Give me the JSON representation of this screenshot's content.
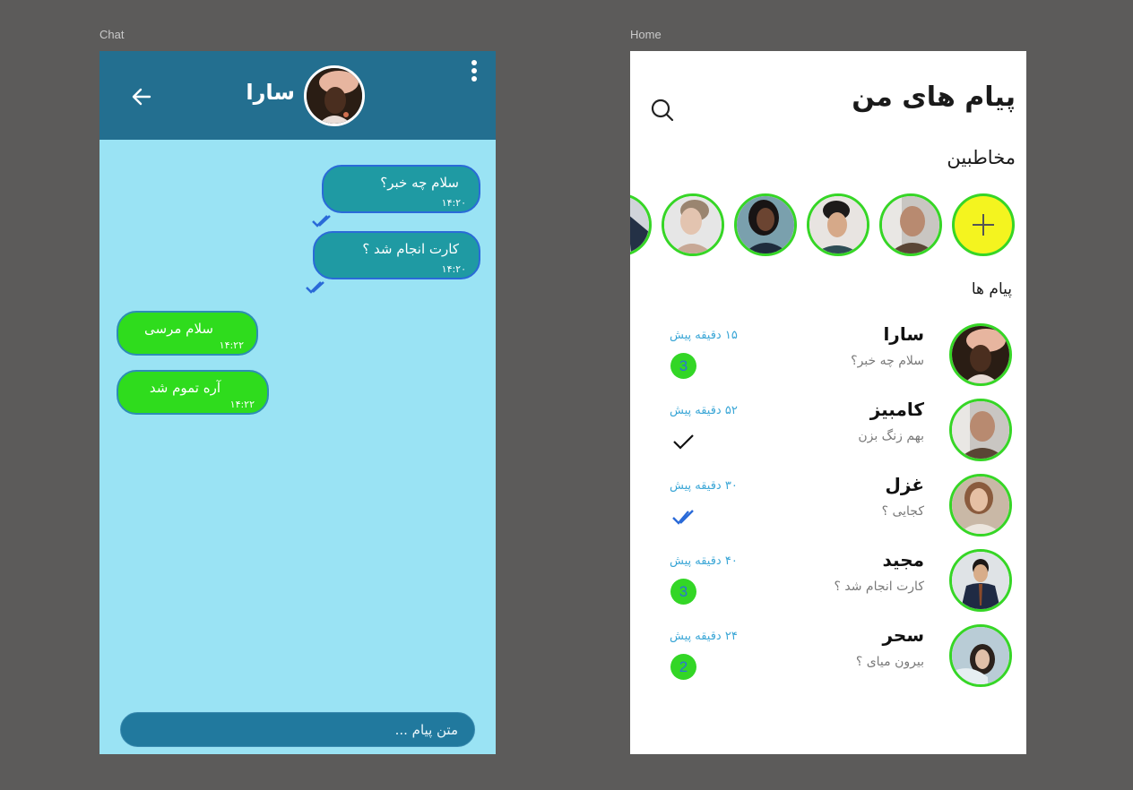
{
  "frames": {
    "chat_label": "Chat",
    "home_label": "Home"
  },
  "chat": {
    "header": {
      "contact_name": "سارا",
      "back_icon": "arrow-left-icon",
      "menu_icon": "more-vertical-icon",
      "avatar_icon": "avatar-sara"
    },
    "messages": [
      {
        "direction": "outgoing",
        "text": "سلام چه خبر؟",
        "time": "۱۴:۲۰",
        "status": "read"
      },
      {
        "direction": "outgoing",
        "text": "کارت انجام شد ؟",
        "time": "۱۴:۲۰",
        "status": "read"
      },
      {
        "direction": "incoming",
        "text": "سلام مرسی",
        "time": "۱۴:۲۲"
      },
      {
        "direction": "incoming",
        "text": "آره تموم شد",
        "time": "۱۴:۲۲"
      }
    ],
    "input": {
      "placeholder": "متن پیام ...",
      "value": ""
    },
    "colors": {
      "header": "#236f90",
      "background": "#9ae3f4",
      "outgoing_bubble": "#1f9aa3",
      "incoming_bubble": "#2fdc1d",
      "input": "#21799e"
    }
  },
  "home": {
    "title": "پیام های من",
    "search_icon": "search-icon",
    "contacts_label": "مخاطبین",
    "add_contact_icon": "plus-icon",
    "contacts": [
      {
        "avatar": "avatar-man-beard"
      },
      {
        "avatar": "avatar-young-man"
      },
      {
        "avatar": "avatar-woman-dark-hair"
      },
      {
        "avatar": "avatar-woman-blonde"
      },
      {
        "avatar": "avatar-partial"
      }
    ],
    "messages_label": "پیام ها",
    "conversations": [
      {
        "name": "سارا",
        "last_message": "سلام چه خبر؟",
        "time": "۱۵ دقیقه پیش",
        "unread": "3",
        "status": "unread"
      },
      {
        "name": "کامبیز",
        "last_message": "بهم زنگ بزن",
        "time": "۵۲ دقیقه پیش",
        "unread": null,
        "status": "sent"
      },
      {
        "name": "غزل",
        "last_message": "کجایی ؟",
        "time": "۳۰ دقیقه پیش",
        "unread": null,
        "status": "read"
      },
      {
        "name": "مجید",
        "last_message": "کارت انجام شد ؟",
        "time": "۴۰ دقیقه پیش",
        "unread": "3",
        "status": "unread"
      },
      {
        "name": "سحر",
        "last_message": "بیرون میای ؟",
        "time": "۲۴ دقیقه پیش",
        "unread": "2",
        "status": "unread"
      }
    ],
    "colors": {
      "avatar_ring": "#36d626",
      "add_button": "#f4f41f",
      "time_text": "#3aa6d6",
      "badge": "#33d626"
    }
  }
}
